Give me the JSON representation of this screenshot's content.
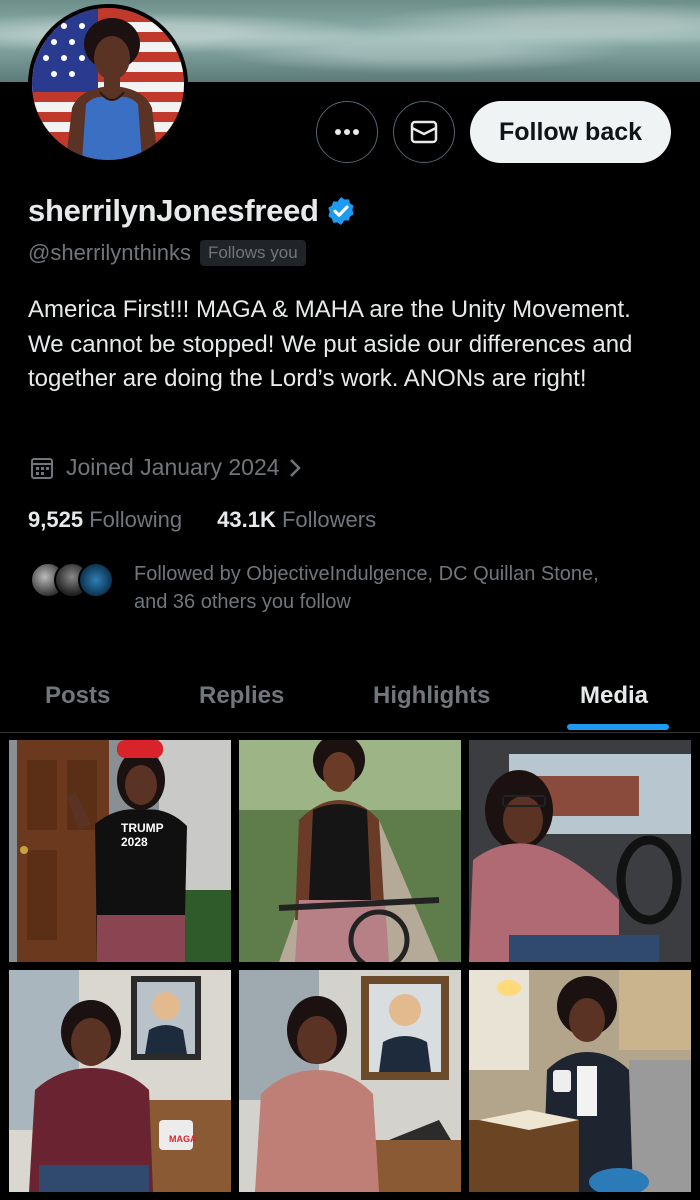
{
  "profile": {
    "display_name": "sherrilynJonesfreed",
    "handle": "@sherrilynthinks",
    "follows_you": "Follows you",
    "bio": "America First!!! MAGA & MAHA are the Unity Movement. We cannot be stopped! We put aside our differences and together are doing the Lord’s work. ANONs are right!",
    "joined": "Joined January 2024",
    "following_count": "9,525",
    "following_label": "Following",
    "followers_count": "43.1K",
    "followers_label": "Followers",
    "followed_by_line1": "Followed by ObjectiveIndulgence, DC Quillan Stone,",
    "followed_by_line2": "and 36 others you follow"
  },
  "actions": {
    "follow_back_label": "Follow back",
    "more_icon": "more-icon",
    "message_icon": "envelope-icon"
  },
  "tabs": [
    "Posts",
    "Replies",
    "Highlights",
    "Media"
  ],
  "active_tab": "Media",
  "media": [
    {
      "shirt_text_1": "TRUMP",
      "shirt_text_2": "2028"
    },
    {},
    {},
    {
      "mug_text": "MAGA"
    },
    {},
    {}
  ],
  "colors": {
    "accent": "#1d9bf0",
    "background": "#000000",
    "secondary_text": "#71767b",
    "follow_button": "#eff3f4"
  }
}
